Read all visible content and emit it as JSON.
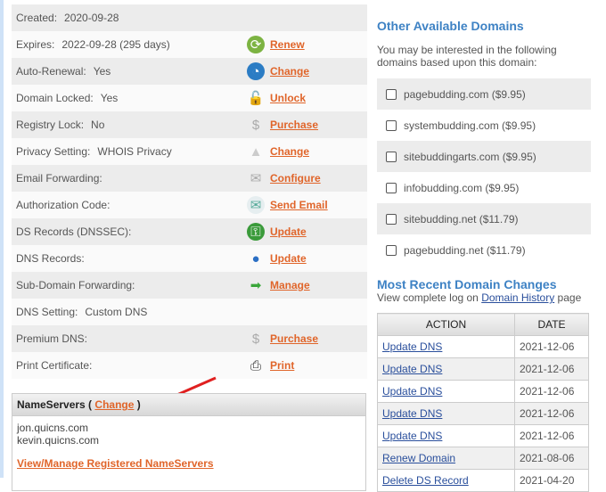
{
  "details": [
    {
      "label": "Created:",
      "value": "2020-09-28",
      "action": null,
      "icon": null
    },
    {
      "label": "Expires:",
      "value": "2022-09-28 (295 days)",
      "action": "Renew",
      "icon": "renew-icon"
    },
    {
      "label": "Auto-Renewal:",
      "value": "Yes",
      "action": "Change",
      "icon": "clock-icon"
    },
    {
      "label": "Domain Locked:",
      "value": "Yes",
      "action": "Unlock",
      "icon": "padlock-icon"
    },
    {
      "label": "Registry Lock:",
      "value": "No",
      "action": "Purchase",
      "icon": "dollar-icon"
    },
    {
      "label": "Privacy Setting:",
      "value": "WHOIS Privacy",
      "action": "Change",
      "icon": "privacy-icon"
    },
    {
      "label": "Email Forwarding:",
      "value": "",
      "action": "Configure",
      "icon": "envelope-icon"
    },
    {
      "label": "Authorization Code:",
      "value": "",
      "action": "Send Email",
      "icon": "email-send-icon"
    },
    {
      "label": "DS Records (DNSSEC):",
      "value": "",
      "action": "Update",
      "icon": "key-icon"
    },
    {
      "label": "DNS Records:",
      "value": "",
      "action": "Update",
      "icon": "globe-icon"
    },
    {
      "label": "Sub-Domain Forwarding:",
      "value": "",
      "action": "Manage",
      "icon": "arrow-right-icon"
    },
    {
      "label": "DNS Setting:",
      "value": "Custom DNS",
      "action": null,
      "icon": null
    },
    {
      "label": "Premium DNS:",
      "value": "",
      "action": "Purchase",
      "icon": "dollar-icon"
    },
    {
      "label": "Print Certificate:",
      "value": "",
      "action": "Print",
      "icon": "printer-icon"
    }
  ],
  "nameservers": {
    "title": "NameServers (",
    "change": "Change",
    "close": ")",
    "servers": [
      "jon.quicns.com",
      "kevin.quicns.com"
    ],
    "manage_link": "View/Manage Registered NameServers"
  },
  "other_domains": {
    "title": "Other Available Domains",
    "intro": "You may be interested in the following domains based upon this domain:",
    "items": [
      "pagebudding.com ($9.95)",
      "systembudding.com ($9.95)",
      "sitebuddingarts.com ($9.95)",
      "infobudding.com ($9.95)",
      "sitebudding.net ($11.79)",
      "pagebudding.net ($11.79)"
    ]
  },
  "recent": {
    "title": "Most Recent Domain Changes",
    "log_prefix": "View complete log on ",
    "log_link": "Domain History",
    "log_suffix": " page",
    "headers": [
      "ACTION",
      "DATE"
    ],
    "rows": [
      [
        "Update DNS",
        "2021-12-06"
      ],
      [
        "Update DNS",
        "2021-12-06"
      ],
      [
        "Update DNS",
        "2021-12-06"
      ],
      [
        "Update DNS",
        "2021-12-06"
      ],
      [
        "Update DNS",
        "2021-12-06"
      ],
      [
        "Renew Domain",
        "2021-08-06"
      ],
      [
        "Delete DS Record",
        "2021-04-20"
      ]
    ]
  }
}
